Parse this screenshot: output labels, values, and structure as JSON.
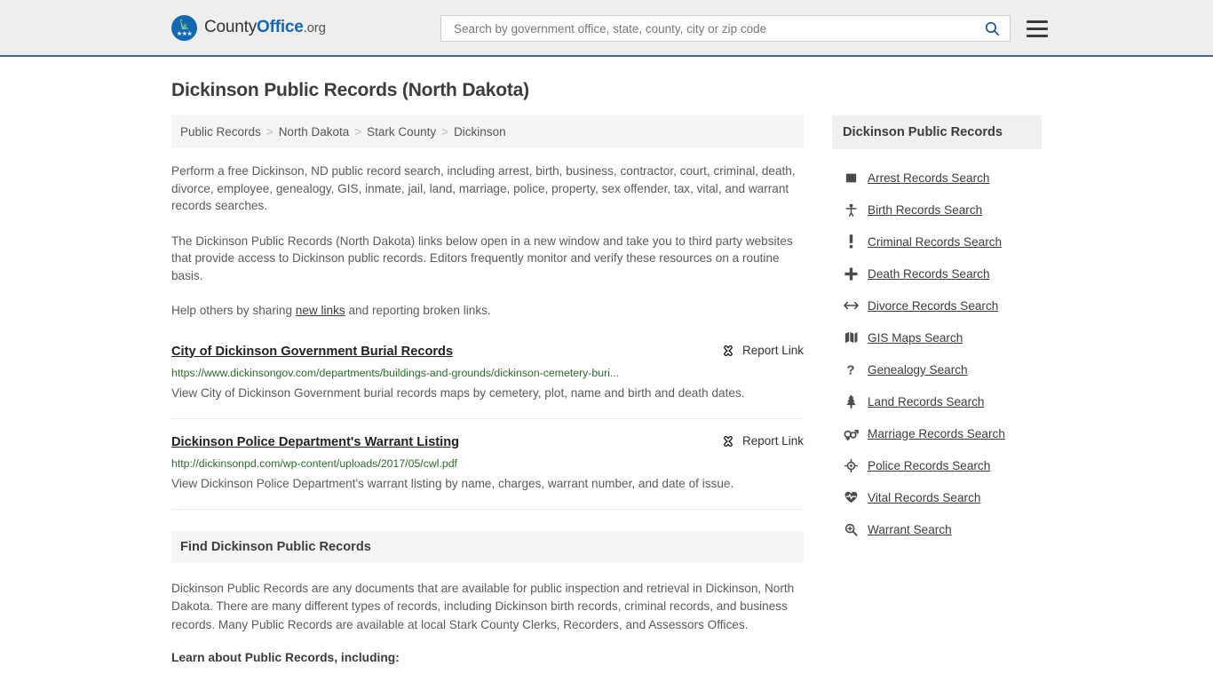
{
  "header": {
    "logo": {
      "text_part1": "County",
      "text_part2": "Office",
      "text_part3": ".org",
      "icon": "eagle-seal-icon"
    },
    "search": {
      "placeholder": "Search by government office, state, county, city or zip code",
      "value": "",
      "button_icon": "search-icon"
    },
    "menu_icon": "hamburger-menu-icon"
  },
  "page": {
    "title": "Dickinson Public Records (North Dakota)"
  },
  "breadcrumb": {
    "separator": ">",
    "items": [
      {
        "label": "Public Records",
        "current": false
      },
      {
        "label": "North Dakota",
        "current": false
      },
      {
        "label": "Stark County",
        "current": false
      },
      {
        "label": "Dickinson",
        "current": true
      }
    ]
  },
  "intro": {
    "paragraph1": "Perform a free Dickinson, ND public record search, including arrest, birth, business, contractor, court, criminal, death, divorce, employee, genealogy, GIS, inmate, jail, land, marriage, police, property, sex offender, tax, vital, and warrant records searches.",
    "paragraph2": "The Dickinson Public Records (North Dakota) links below open in a new window and take you to third party websites that provide access to Dickinson public records. Editors frequently monitor and verify these resources on a routine basis.",
    "paragraph3_before": "Help others by sharing ",
    "paragraph3_link": "new links",
    "paragraph3_after": " and reporting broken links."
  },
  "results": [
    {
      "title": "City of Dickinson Government Burial Records",
      "url": "https://www.dickinsongov.com/departments/buildings-and-grounds/dickinson-cemetery-buri...",
      "description": "View City of Dickinson Government burial records maps by cemetery, plot, name and birth and death dates.",
      "report_label": "Report Link",
      "report_icon": "broken-link-icon"
    },
    {
      "title": "Dickinson Police Department's Warrant Listing",
      "url": "http://dickinsonpd.com/wp-content/uploads/2017/05/cwl.pdf",
      "description": "View Dickinson Police Department's warrant listing by name, charges, warrant number, and date of issue.",
      "report_label": "Report Link",
      "report_icon": "broken-link-icon"
    }
  ],
  "find_section": {
    "title": "Find Dickinson Public Records",
    "body": "Dickinson Public Records are any documents that are available for public inspection and retrieval in Dickinson, North Dakota. There are many different types of records, including Dickinson birth records, criminal records, and business records. Many Public Records are available at local Stark County Clerks, Recorders, and Assessors Offices.",
    "subheading": "Learn about Public Records, including:"
  },
  "sidebar": {
    "title": "Dickinson Public Records",
    "items": [
      {
        "label": "Arrest Records Search",
        "icon": "fingerprint-icon"
      },
      {
        "label": "Birth Records Search",
        "icon": "baby-icon"
      },
      {
        "label": "Criminal Records Search",
        "icon": "exclamation-icon"
      },
      {
        "label": "Death Records Search",
        "icon": "cross-plus-icon"
      },
      {
        "label": "Divorce Records Search",
        "icon": "left-right-arrow-icon"
      },
      {
        "label": "GIS Maps Search",
        "icon": "map-icon"
      },
      {
        "label": "Genealogy Search",
        "icon": "question-mark-icon"
      },
      {
        "label": "Land Records Search",
        "icon": "tree-icon"
      },
      {
        "label": "Marriage Records Search",
        "icon": "venus-mars-icon"
      },
      {
        "label": "Police Records Search",
        "icon": "police-badge-icon"
      },
      {
        "label": "Vital Records Search",
        "icon": "heartbeat-icon"
      },
      {
        "label": "Warrant Search",
        "icon": "search-plus-icon"
      }
    ]
  },
  "colors": {
    "brand_blue": "#1268b3",
    "header_bg": "#eeeeee",
    "header_border": "#36699e",
    "panel_bg": "#f5f5f5",
    "url_green": "#2a6b2a",
    "body_text": "#5b5b5b"
  }
}
